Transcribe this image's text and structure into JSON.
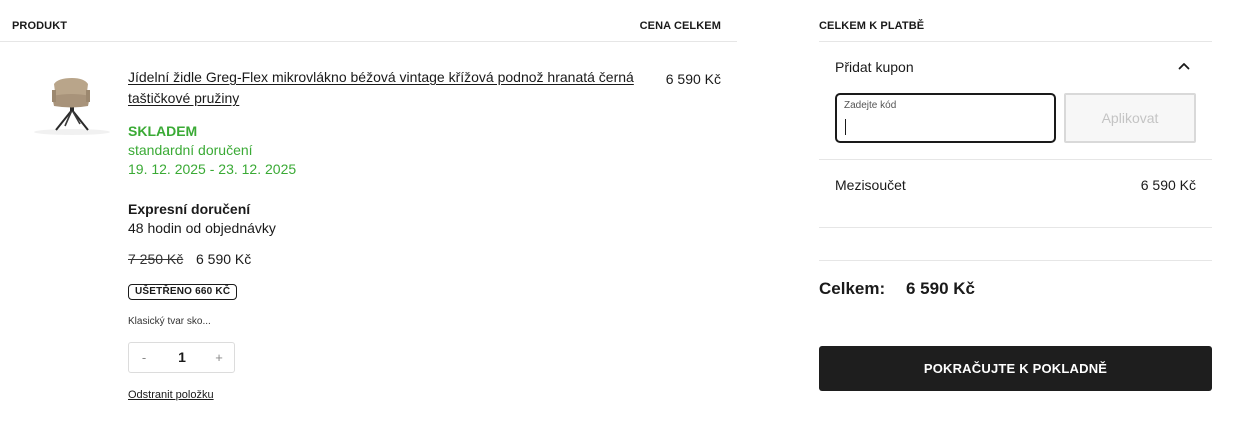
{
  "cart": {
    "headers": {
      "product": "PRODUKT",
      "total": "CENA CELKEM"
    },
    "item": {
      "image_icon": "dining-chair-image",
      "name": "Jídelní židle Greg-Flex mikrovlákno béžová vintage křížová podnož hranatá černá taštičkové pružiny",
      "line_total": "6 590 Kč",
      "stock_status": "SKLADEM",
      "shipping_type": "standardní doručení",
      "shipping_dates": "19. 12. 2025 - 23. 12. 2025",
      "express_title": "Expresní doručení",
      "express_subtitle": "48 hodin od objednávky",
      "old_price": "7 250 Kč",
      "price": "6 590 Kč",
      "saved_badge": "UŠETŘENO 660 KČ",
      "short_description": "Klasický tvar sko...",
      "quantity": {
        "minus_label": "-",
        "value": "1",
        "plus_label": "+"
      },
      "remove_label": "Odstranit položku"
    },
    "colors": {
      "stock_green": "#3aaa35",
      "text": "#1a1a1a",
      "divider": "#e6e6e6"
    }
  },
  "summary": {
    "heading": "CELKEM K PLATBĚ",
    "coupon": {
      "toggle_label": "Přidat kupon",
      "toggle_icon": "chevron-up-icon",
      "field_label": "Zadejte kód",
      "input_value": "",
      "apply_label": "Aplikovat"
    },
    "subtotal_label": "Mezisoučet",
    "subtotal_value": "6 590 Kč",
    "total_label": "Celkem:",
    "total_value": "6 590 Kč",
    "checkout_label": "POKRAČUJTE K POKLADNĚ",
    "colors": {
      "checkout_bg": "#1e1e1e",
      "apply_disabled_text": "#c4c4c4"
    }
  }
}
